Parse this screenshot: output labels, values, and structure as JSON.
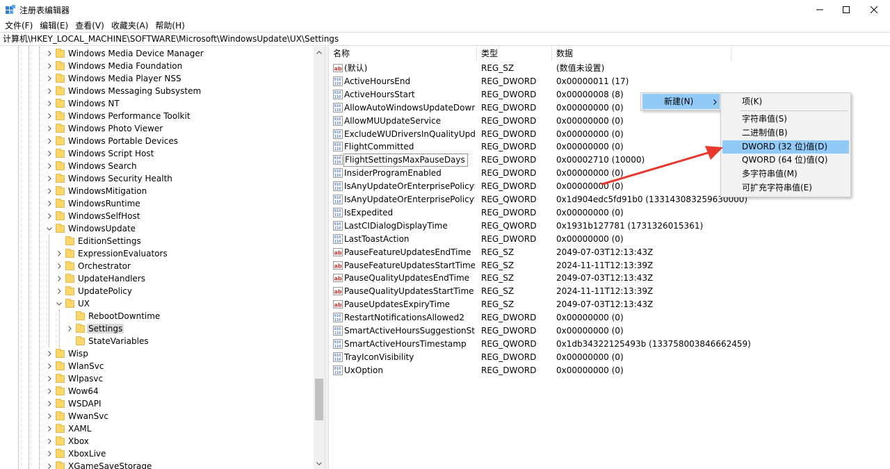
{
  "window": {
    "title": "注册表编辑器",
    "minimize_glyph": "—",
    "maximize_glyph": "☐",
    "close_glyph": "✕"
  },
  "menu": [
    "文件(F)",
    "编辑(E)",
    "查看(V)",
    "收藏夹(A)",
    "帮助(H)"
  ],
  "address": "计算机\\HKEY_LOCAL_MACHINE\\SOFTWARE\\Microsoft\\WindowsUpdate\\UX\\Settings",
  "tree": {
    "items": [
      {
        "label": "Windows Media Device Manager",
        "level": 0,
        "expander": "collapsed"
      },
      {
        "label": "Windows Media Foundation",
        "level": 0,
        "expander": "collapsed"
      },
      {
        "label": "Windows Media Player NSS",
        "level": 0,
        "expander": "collapsed"
      },
      {
        "label": "Windows Messaging Subsystem",
        "level": 0,
        "expander": "collapsed"
      },
      {
        "label": "Windows NT",
        "level": 0,
        "expander": "collapsed"
      },
      {
        "label": "Windows Performance Toolkit",
        "level": 0,
        "expander": "collapsed"
      },
      {
        "label": "Windows Photo Viewer",
        "level": 0,
        "expander": "collapsed"
      },
      {
        "label": "Windows Portable Devices",
        "level": 0,
        "expander": "collapsed"
      },
      {
        "label": "Windows Script Host",
        "level": 0,
        "expander": "collapsed"
      },
      {
        "label": "Windows Search",
        "level": 0,
        "expander": "collapsed"
      },
      {
        "label": "Windows Security Health",
        "level": 0,
        "expander": "collapsed"
      },
      {
        "label": "WindowsMitigation",
        "level": 0,
        "expander": "collapsed"
      },
      {
        "label": "WindowsRuntime",
        "level": 0,
        "expander": "collapsed"
      },
      {
        "label": "WindowsSelfHost",
        "level": 0,
        "expander": "collapsed"
      },
      {
        "label": "WindowsUpdate",
        "level": 0,
        "expander": "expanded"
      },
      {
        "label": "EditionSettings",
        "level": 1,
        "expander": "none"
      },
      {
        "label": "ExpressionEvaluators",
        "level": 1,
        "expander": "collapsed"
      },
      {
        "label": "Orchestrator",
        "level": 1,
        "expander": "collapsed"
      },
      {
        "label": "UpdateHandlers",
        "level": 1,
        "expander": "collapsed"
      },
      {
        "label": "UpdatePolicy",
        "level": 1,
        "expander": "collapsed"
      },
      {
        "label": "UX",
        "level": 1,
        "expander": "expanded"
      },
      {
        "label": "RebootDowntime",
        "level": 2,
        "expander": "none"
      },
      {
        "label": "Settings",
        "level": 2,
        "expander": "collapsed",
        "selected": true
      },
      {
        "label": "StateVariables",
        "level": 2,
        "expander": "none"
      },
      {
        "label": "Wisp",
        "level": 0,
        "expander": "collapsed"
      },
      {
        "label": "WlanSvc",
        "level": 0,
        "expander": "collapsed"
      },
      {
        "label": "Wlpasvc",
        "level": 0,
        "expander": "collapsed"
      },
      {
        "label": "Wow64",
        "level": 0,
        "expander": "collapsed"
      },
      {
        "label": "WSDAPI",
        "level": 0,
        "expander": "collapsed"
      },
      {
        "label": "WwanSvc",
        "level": 0,
        "expander": "collapsed"
      },
      {
        "label": "XAML",
        "level": 0,
        "expander": "collapsed"
      },
      {
        "label": "Xbox",
        "level": 0,
        "expander": "collapsed"
      },
      {
        "label": "XboxLive",
        "level": 0,
        "expander": "collapsed"
      },
      {
        "label": "XGameSaveStorage",
        "level": 0,
        "expander": "collapsed"
      }
    ]
  },
  "values": {
    "columns": [
      "名称",
      "类型",
      "数据"
    ],
    "rows": [
      {
        "icon": "string-value-icon",
        "name": "(默认)",
        "type": "REG_SZ",
        "data": "(数值未设置)"
      },
      {
        "icon": "binary-value-icon",
        "name": "ActiveHoursEnd",
        "type": "REG_DWORD",
        "data": "0x00000011 (17)"
      },
      {
        "icon": "binary-value-icon",
        "name": "ActiveHoursStart",
        "type": "REG_DWORD",
        "data": "0x00000008 (8)"
      },
      {
        "icon": "binary-value-icon",
        "name": "AllowAutoWindowsUpdateDownlo...",
        "type": "REG_DWORD",
        "data": "0x00000000 (0)"
      },
      {
        "icon": "binary-value-icon",
        "name": "AllowMUUpdateService",
        "type": "REG_DWORD",
        "data": "0x00000000 (0)"
      },
      {
        "icon": "binary-value-icon",
        "name": "ExcludeWUDriversInQualityUpdate",
        "type": "REG_DWORD",
        "data": "0x00000000 (0)"
      },
      {
        "icon": "binary-value-icon",
        "name": "FlightCommitted",
        "type": "REG_DWORD",
        "data": "0x00000000 (0)"
      },
      {
        "icon": "binary-value-icon",
        "name": "FlightSettingsMaxPauseDays",
        "type": "REG_DWORD",
        "data": "0x00002710 (10000)",
        "focused": true
      },
      {
        "icon": "binary-value-icon",
        "name": "InsiderProgramEnabled",
        "type": "REG_DWORD",
        "data": "0x00000000 (0)"
      },
      {
        "icon": "binary-value-icon",
        "name": "IsAnyUpdateOrEnterprisePolicySet",
        "type": "REG_DWORD",
        "data": "0x00000000 (0)"
      },
      {
        "icon": "binary-value-icon",
        "name": "IsAnyUpdateOrEnterprisePolicySet...",
        "type": "REG_QWORD",
        "data": "0x1d904edc5fd91b0 (133143083259630000)"
      },
      {
        "icon": "binary-value-icon",
        "name": "IsExpedited",
        "type": "REG_DWORD",
        "data": "0x00000000 (0)"
      },
      {
        "icon": "binary-value-icon",
        "name": "LastCIDialogDisplayTime",
        "type": "REG_QWORD",
        "data": "0x1931b127781 (1731326015361)"
      },
      {
        "icon": "binary-value-icon",
        "name": "LastToastAction",
        "type": "REG_DWORD",
        "data": "0x00000000 (0)"
      },
      {
        "icon": "string-value-icon",
        "name": "PauseFeatureUpdatesEndTime",
        "type": "REG_SZ",
        "data": "2049-07-03T12:13:43Z"
      },
      {
        "icon": "string-value-icon",
        "name": "PauseFeatureUpdatesStartTime",
        "type": "REG_SZ",
        "data": "2024-11-11T12:13:39Z"
      },
      {
        "icon": "string-value-icon",
        "name": "PauseQualityUpdatesEndTime",
        "type": "REG_SZ",
        "data": "2049-07-03T12:13:43Z"
      },
      {
        "icon": "string-value-icon",
        "name": "PauseQualityUpdatesStartTime",
        "type": "REG_SZ",
        "data": "2024-11-11T12:13:39Z"
      },
      {
        "icon": "string-value-icon",
        "name": "PauseUpdatesExpiryTime",
        "type": "REG_SZ",
        "data": "2049-07-03T12:13:43Z"
      },
      {
        "icon": "binary-value-icon",
        "name": "RestartNotificationsAllowed2",
        "type": "REG_DWORD",
        "data": "0x00000000 (0)"
      },
      {
        "icon": "binary-value-icon",
        "name": "SmartActiveHoursSuggestionState",
        "type": "REG_DWORD",
        "data": "0x00000000 (0)"
      },
      {
        "icon": "binary-value-icon",
        "name": "SmartActiveHoursTimestamp",
        "type": "REG_QWORD",
        "data": "0x1db34322125493b (133758003846662459)"
      },
      {
        "icon": "binary-value-icon",
        "name": "TrayIconVisibility",
        "type": "REG_DWORD",
        "data": "0x00000000 (0)"
      },
      {
        "icon": "binary-value-icon",
        "name": "UxOption",
        "type": "REG_DWORD",
        "data": "0x00000000 (0)"
      }
    ]
  },
  "context_menu": {
    "new_label": "新建(N)",
    "submenu": [
      {
        "label": "项(K)"
      },
      {
        "separator": true
      },
      {
        "label": "字符串值(S)"
      },
      {
        "label": "二进制值(B)"
      },
      {
        "label": "DWORD (32 位)值(D)",
        "highlighted": true
      },
      {
        "label": "QWORD (64 位)值(Q)"
      },
      {
        "label": "多字符串值(M)"
      },
      {
        "label": "可扩充字符串值(E)"
      }
    ]
  },
  "colors": {
    "menu_highlight": "#91c9f7",
    "annotation_arrow": "#e8372c",
    "folder": "#fbd66a"
  }
}
